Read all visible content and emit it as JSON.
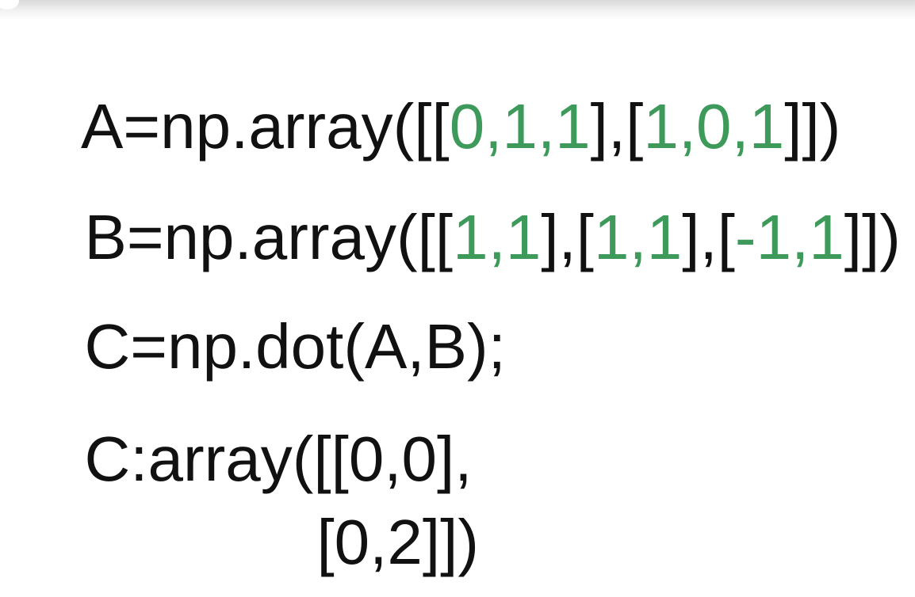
{
  "colors": {
    "text": "#111111",
    "number_highlight": "#3d9a5a",
    "background": "#ffffff"
  },
  "lines": [
    {
      "tokens": [
        {
          "text": "A=np.array([[",
          "highlight": false
        },
        {
          "text": "0,1,1",
          "highlight": true
        },
        {
          "text": "],[",
          "highlight": false
        },
        {
          "text": "1,0,1",
          "highlight": true
        },
        {
          "text": "]])",
          "highlight": false
        }
      ]
    },
    {
      "tokens": [
        {
          "text": "B=np.array([[",
          "highlight": false
        },
        {
          "text": "1,1",
          "highlight": true
        },
        {
          "text": "],[",
          "highlight": false
        },
        {
          "text": "1,1",
          "highlight": true
        },
        {
          "text": "],[",
          "highlight": false
        },
        {
          "text": "-1,1",
          "highlight": true
        },
        {
          "text": "]])",
          "highlight": false
        }
      ]
    },
    {
      "tokens": [
        {
          "text": "C=np.dot(A,B);",
          "highlight": false
        }
      ]
    },
    {
      "tokens": [
        {
          "text": "C:array([[0,0],",
          "highlight": false
        }
      ]
    },
    {
      "tokens": [
        {
          "text": "[0,2]])",
          "highlight": false
        }
      ]
    }
  ]
}
